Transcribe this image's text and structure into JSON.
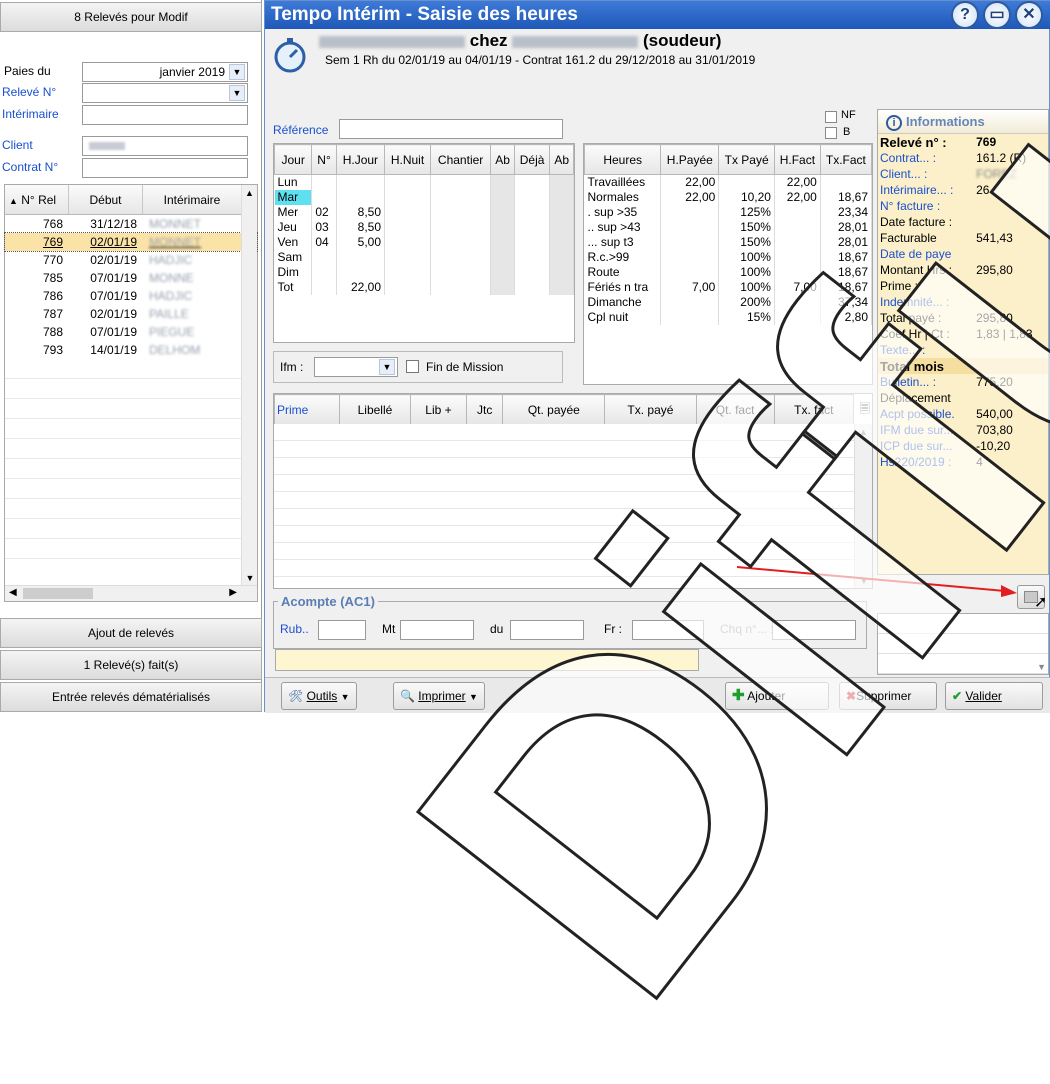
{
  "left": {
    "header": "8 Relevés pour Modif",
    "paies_label": "Paies du",
    "paies_value": "janvier 2019",
    "releve_label": "Relevé N°",
    "interimaire_label": "Intérimaire",
    "client_label": "Client",
    "contrat_label": "Contrat N°",
    "columns": [
      "N° Rel",
      "Début",
      "Intérimaire"
    ],
    "rows": [
      {
        "num": "768",
        "date": "31/12/18",
        "name": "MONNET"
      },
      {
        "num": "769",
        "date": "02/01/19",
        "name": "MONNET"
      },
      {
        "num": "770",
        "date": "02/01/19",
        "name": "HADJIC"
      },
      {
        "num": "785",
        "date": "07/01/19",
        "name": "MONNE"
      },
      {
        "num": "786",
        "date": "07/01/19",
        "name": "HADJIC"
      },
      {
        "num": "787",
        "date": "02/01/19",
        "name": "PAILLE"
      },
      {
        "num": "788",
        "date": "07/01/19",
        "name": "PIEGUE"
      },
      {
        "num": "793",
        "date": "14/01/19",
        "name": "DELHOM"
      }
    ],
    "btn_ajout": "Ajout de relevés",
    "btn_fait": "1 Relevé(s) fait(s)",
    "btn_entree": "Entrée relevés dématérialisés"
  },
  "window": {
    "title": "Tempo Intérim - Saisie des heures",
    "help_icon_text": "?",
    "emp_chez": "chez",
    "emp_role": "(soudeur)",
    "emp_name": "MONNET Bernard",
    "emp_company": "FOREZ MINHES",
    "subtitle": "Sem 1  Rh du 02/01/19 au 04/01/19 - Contrat  161.2 du 29/12/2018 au 31/01/2019",
    "reference_label": "Référence",
    "nf_label": "NF",
    "b_label": "B"
  },
  "days": {
    "columns": [
      "Jour",
      "N°",
      "H.Jour",
      "H.Nuit",
      "Chantier",
      "Ab",
      "Déjà",
      "Ab"
    ],
    "rows": [
      {
        "jour": "Lun",
        "n": "",
        "hj": ""
      },
      {
        "jour": "Mar",
        "n": "",
        "hj": ""
      },
      {
        "jour": "Mer",
        "n": "02",
        "hj": "8,50"
      },
      {
        "jour": "Jeu",
        "n": "03",
        "hj": "8,50"
      },
      {
        "jour": "Ven",
        "n": "04",
        "hj": "5,00"
      },
      {
        "jour": "Sam",
        "n": "",
        "hj": ""
      },
      {
        "jour": "Dim",
        "n": "",
        "hj": ""
      },
      {
        "jour": "Tot",
        "n": "",
        "hj": "22,00"
      }
    ],
    "ifm_label": "Ifm :",
    "fin_mission": "Fin de Mission"
  },
  "hours": {
    "columns": [
      "Heures",
      "H.Payée",
      "Tx Payé",
      "H.Fact",
      "Tx.Fact"
    ],
    "rows": [
      {
        "h": "Travaillées",
        "hp": "22,00",
        "tp": "",
        "hf": "22,00",
        "tf": ""
      },
      {
        "h": "Normales",
        "hp": "22,00",
        "tp": "10,20",
        "hf": "22,00",
        "tf": "18,67"
      },
      {
        "h": ". sup >35",
        "hp": "",
        "tp": "125%",
        "hf": "",
        "tf": "23,34"
      },
      {
        "h": ".. sup >43",
        "hp": "",
        "tp": "150%",
        "hf": "",
        "tf": "28,01"
      },
      {
        "h": "... sup t3",
        "hp": "",
        "tp": "150%",
        "hf": "",
        "tf": "28,01"
      },
      {
        "h": "R.c.>99",
        "hp": "",
        "tp": "100%",
        "hf": "",
        "tf": "18,67"
      },
      {
        "h": "Route",
        "hp": "",
        "tp": "100%",
        "hf": "",
        "tf": "18,67"
      },
      {
        "h": "Fériés n tra",
        "hp": "7,00",
        "tp": "100%",
        "hf": "7,00",
        "tf": "18,67"
      },
      {
        "h": "Dimanche",
        "hp": "",
        "tp": "200%",
        "hf": "",
        "tf": "37,34"
      },
      {
        "h": "Cpl nuit",
        "hp": "",
        "tp": "15%",
        "hf": "",
        "tf": "2,80"
      }
    ]
  },
  "prime": {
    "columns": [
      "Prime",
      "Libellé",
      "Lib +",
      "Jtc",
      "Qt. payée",
      "Tx. payé",
      "Qt. fact",
      "Tx. fact"
    ]
  },
  "acompte": {
    "title": "Acompte (AC1)",
    "rub": "Rub..",
    "mt": "Mt",
    "du": "du",
    "fr": "Fr :",
    "chq": "Chq n°... :"
  },
  "info": {
    "title": "Informations",
    "rows": [
      {
        "k": "Relevé n° :",
        "v": "769",
        "bold": true
      },
      {
        "k": "Contrat... :",
        "v": "161.2 (R)",
        "blue": true
      },
      {
        "k": "Client... :",
        "v": "FOREZ",
        "blue": true
      },
      {
        "k": "Intérimaire... :",
        "v": "26",
        "blue": true
      },
      {
        "k": "N° facture :",
        "v": "",
        "blue": true
      },
      {
        "k": "Date facture :",
        "v": ""
      },
      {
        "k": "Facturable",
        "v": "541,43"
      },
      {
        "k": "Date de paye",
        "v": "",
        "blue": true
      },
      {
        "k": "Montant Hrs :",
        "v": "295,80"
      },
      {
        "k": "Prime :",
        "v": ""
      },
      {
        "k": "Indemnité... :",
        "v": "",
        "blue": true
      },
      {
        "k": "Total payé :",
        "v": "295,80"
      },
      {
        "k": "Coef Hr | Ct :",
        "v": "1,83 | 1,83"
      },
      {
        "k": "Texte... :",
        "v": "",
        "blue": true
      },
      {
        "k": "Total mois",
        "v": "",
        "bold": true,
        "section": true
      },
      {
        "k": "Bulletin... :",
        "v": "775,20",
        "blue": true
      },
      {
        "k": "Déplacement",
        "v": ""
      },
      {
        "k": "Acpt possible.",
        "v": "540,00",
        "blue": true
      },
      {
        "k": "IFM due sur...",
        "v": "703,80",
        "blue": true
      },
      {
        "k": "ICP due sur...",
        "v": "-10,20",
        "blue": true
      },
      {
        "k": "Hs220/2019 :",
        "v": "4",
        "blue": true
      }
    ]
  },
  "toolbar": {
    "outils": "Outils",
    "imprimer": "Imprimer",
    "ajouter": "Ajouter",
    "supprimer": "Supprimer",
    "valider": "Valider"
  },
  "watermark": "Diffusion",
  "colors": {
    "title_blue": "#2a63c4",
    "selected_row": "#fbe3a8",
    "info_bg": "#fbf0c9",
    "arrow": "#e02020"
  }
}
